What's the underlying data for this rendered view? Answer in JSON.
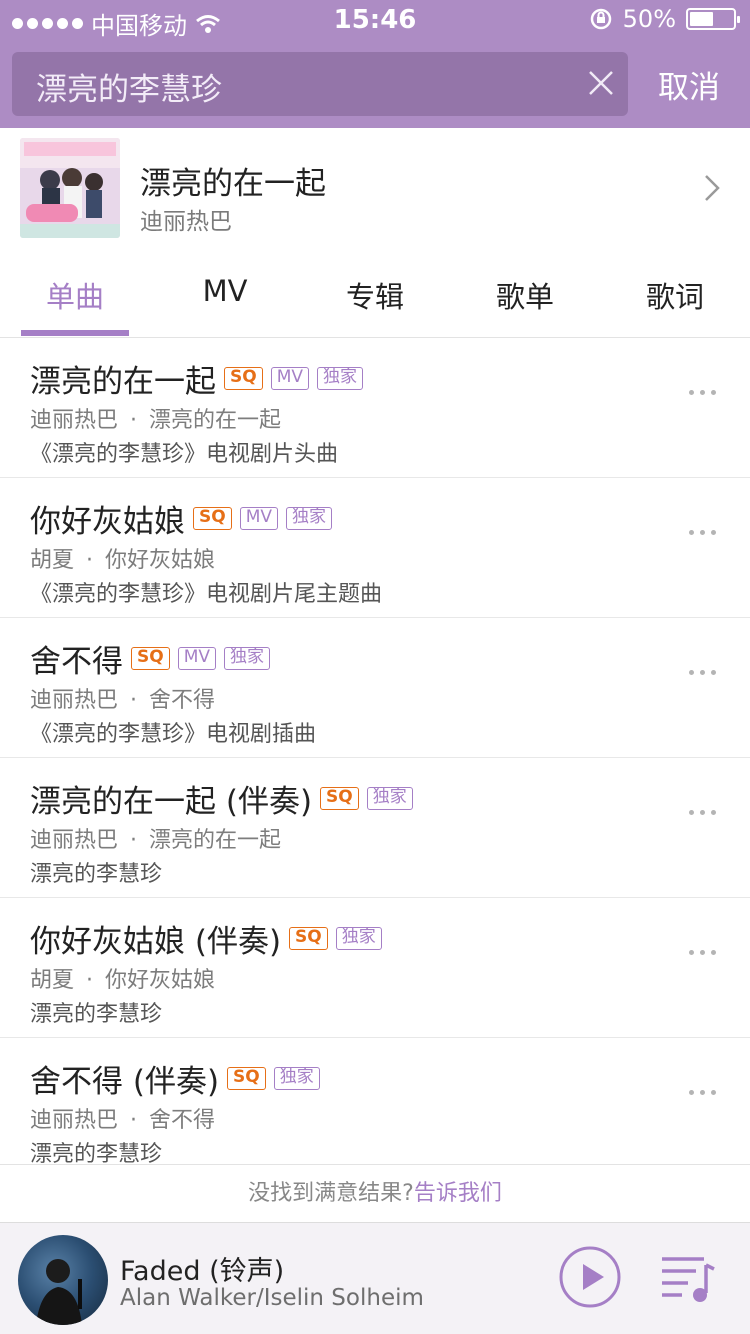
{
  "status_bar": {
    "carrier": "中国移动",
    "time": "15:46",
    "battery": "50%",
    "battery_level": 0.5
  },
  "search": {
    "query": "漂亮的李慧珍",
    "cancel_label": "取消"
  },
  "album": {
    "title": "漂亮的在一起",
    "artist": "迪丽热巴"
  },
  "tabs": [
    {
      "label": "单曲",
      "active": true
    },
    {
      "label": "MV"
    },
    {
      "label": "专辑"
    },
    {
      "label": "歌单"
    },
    {
      "label": "歌词"
    }
  ],
  "badges": {
    "sq": "SQ",
    "mv": "MV",
    "exclusive": "独家"
  },
  "separator": "·",
  "songs": [
    {
      "title": "漂亮的在一起",
      "artist": "迪丽热巴",
      "album": "漂亮的在一起",
      "note": "《漂亮的李慧珍》电视剧片头曲",
      "mv": true
    },
    {
      "title": "你好灰姑娘",
      "artist": "胡夏",
      "album": "你好灰姑娘",
      "note": "《漂亮的李慧珍》电视剧片尾主题曲",
      "mv": true
    },
    {
      "title": "舍不得",
      "artist": "迪丽热巴",
      "album": "舍不得",
      "note": "《漂亮的李慧珍》电视剧插曲",
      "mv": true
    },
    {
      "title": "漂亮的在一起 (伴奏)",
      "artist": "迪丽热巴",
      "album": "漂亮的在一起",
      "note": "漂亮的李慧珍",
      "mv": false
    },
    {
      "title": "你好灰姑娘 (伴奏)",
      "artist": "胡夏",
      "album": "你好灰姑娘",
      "note": "漂亮的李慧珍",
      "mv": false
    },
    {
      "title": "舍不得 (伴奏)",
      "artist": "迪丽热巴",
      "album": "舍不得",
      "note": "漂亮的李慧珍",
      "mv": false
    }
  ],
  "feedback": {
    "text": "没找到满意结果?",
    "link": "告诉我们"
  },
  "player": {
    "title": "Faded (铃声)",
    "artist": "Alan Walker/Iselin Solheim"
  },
  "colors": {
    "accent": "#a57fc6",
    "header": "#ad8cc4",
    "sq": "#e66f17"
  }
}
